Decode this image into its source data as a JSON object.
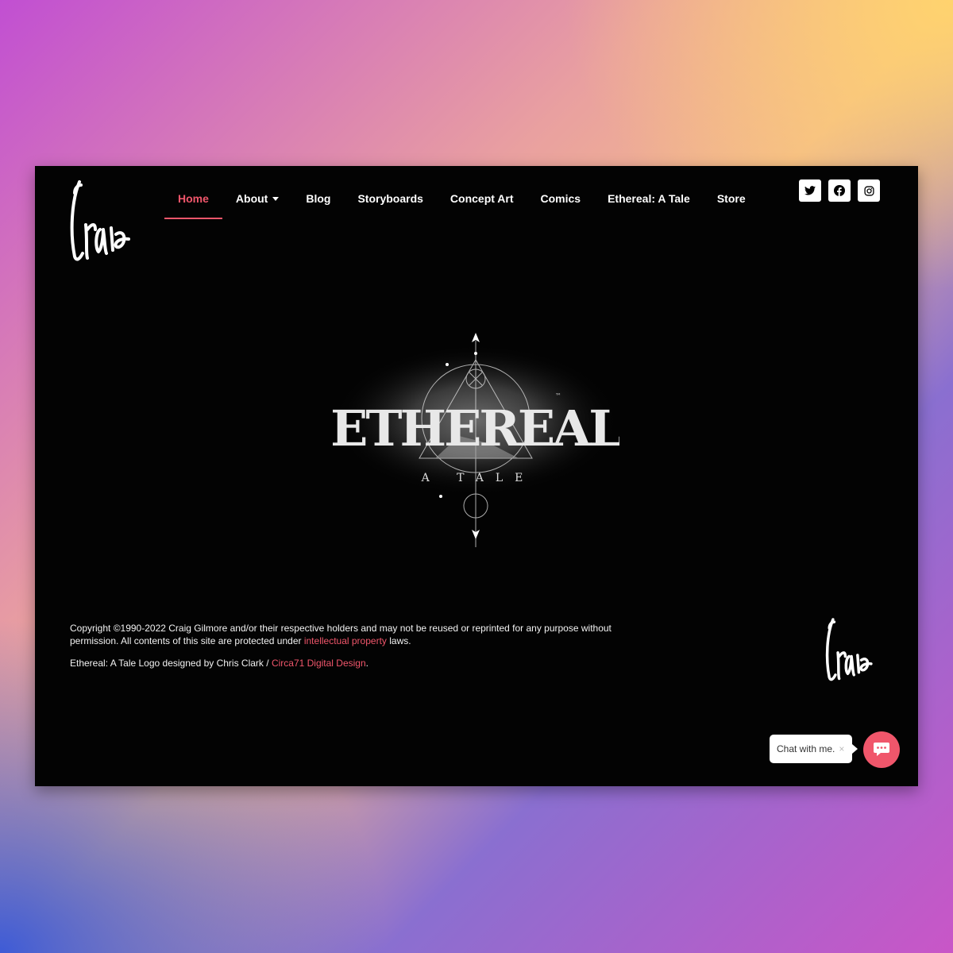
{
  "brand": {
    "logo_text": "Craig"
  },
  "nav": {
    "items": [
      {
        "label": "Home",
        "active": true
      },
      {
        "label": "About",
        "has_dropdown": true
      },
      {
        "label": "Blog"
      },
      {
        "label": "Storyboards"
      },
      {
        "label": "Concept Art"
      },
      {
        "label": "Comics"
      },
      {
        "label": "Ethereal: A Tale"
      },
      {
        "label": "Store"
      }
    ]
  },
  "social": {
    "icons": [
      "twitter-icon",
      "facebook-icon",
      "instagram-icon"
    ]
  },
  "hero": {
    "logo_title": "ETHEREAL",
    "logo_subtitle": "A TALE",
    "trademark": "™"
  },
  "footer": {
    "copyright_pre": "Copyright ©1990-2022 Craig Gilmore and/or their respective holders and may not be reused or reprinted for any purpose without permission. All contents of this site are protected under",
    "ip_link": "intellectual property",
    "copyright_post": "laws.",
    "credit_pre": "Ethereal: A Tale Logo designed by Chris Clark /",
    "credit_link": "Circa71 Digital Design",
    "credit_post": "."
  },
  "chat": {
    "label": "Chat with me.",
    "close": "×"
  },
  "colors": {
    "accent": "#f0566b",
    "background": "#030303",
    "text": "#ffffff"
  }
}
